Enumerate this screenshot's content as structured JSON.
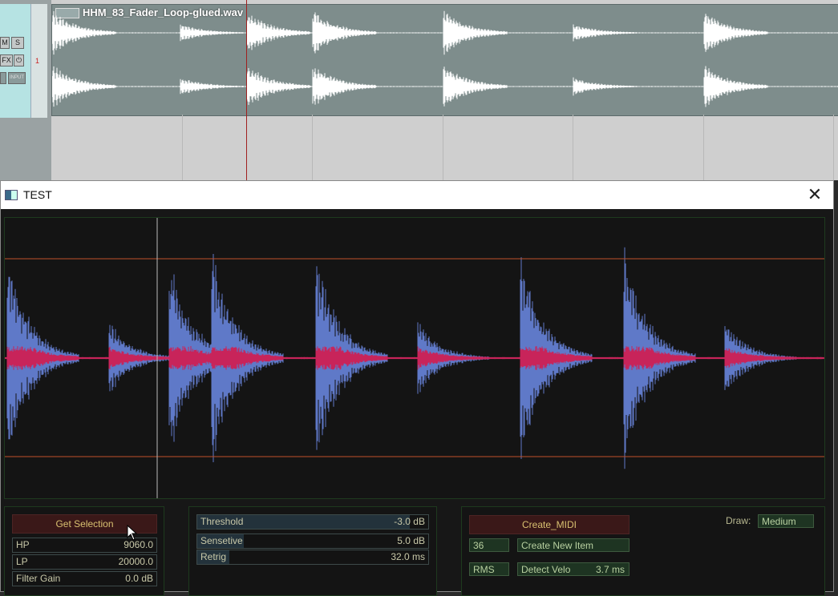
{
  "daw": {
    "item_name": "HHM_83_Fader_Loop-glued.wav",
    "track_number": "1",
    "buttons": {
      "mute": "M",
      "solo": "S",
      "fx": "FX",
      "input": "INPUT"
    }
  },
  "window": {
    "title": "TEST",
    "close_glyph": "✕"
  },
  "filter_panel": {
    "get_selection_label": "Get Selection",
    "hp": {
      "label": "HP",
      "value": "9060.0"
    },
    "lp": {
      "label": "LP",
      "value": "20000.0"
    },
    "filter_gain": {
      "label": "Filter Gain",
      "value": "0.0 dB"
    }
  },
  "detect_panel": {
    "threshold": {
      "label": "Threshold",
      "value": "-3.0 dB",
      "fill": 0.92
    },
    "sensetive": {
      "label": "Sensetive",
      "value": "5.0 dB",
      "fill": 0.2
    },
    "retrig": {
      "label": "Retrig",
      "value": "32.0 ms",
      "fill": 0.14
    }
  },
  "midi_panel": {
    "create_midi_label": "Create_MIDI",
    "note_value": "36",
    "create_new_item_label": "Create New Item",
    "rms_label": "RMS",
    "detect_velo": {
      "label": "Detect Velo",
      "value": "3.7 ms"
    },
    "draw_label": "Draw:",
    "draw_value": "Medium"
  },
  "colors": {
    "wave_blue": "#5f79c8",
    "wave_red": "#c8245a",
    "threshold_line": "#c0502a",
    "panel_border": "#1e3a1e"
  }
}
